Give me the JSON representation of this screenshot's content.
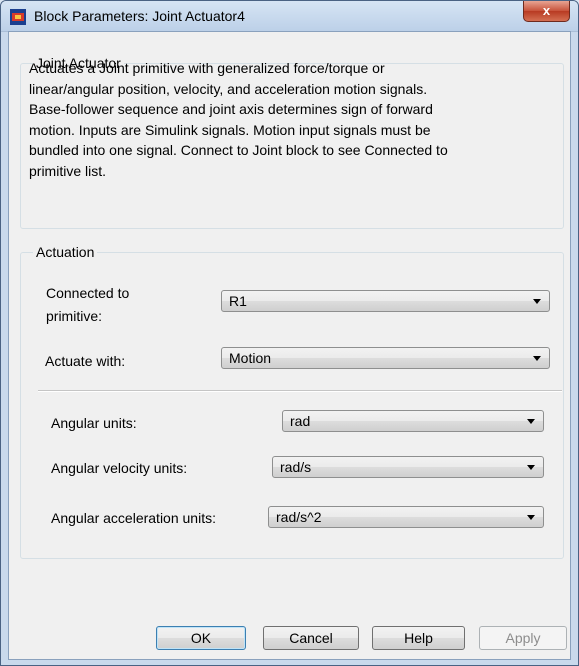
{
  "window": {
    "title": "Block Parameters: Joint Actuator4",
    "close_label": "x"
  },
  "block": {
    "group_title": "Joint Actuator",
    "description": [
      "Actuates a Joint primitive with generalized force/torque or",
      "linear/angular position, velocity, and acceleration motion signals.",
      "Base-follower sequence and joint axis determines sign of forward",
      "motion. Inputs are Simulink signals. Motion input signals must be",
      "bundled into one signal. Connect to Joint block to see Connected to",
      "primitive list."
    ]
  },
  "actuation": {
    "group_title": "Actuation",
    "connected_label_line1": "Connected to",
    "connected_label_line2": "primitive:",
    "connected_value": "R1",
    "actuate_label": "Actuate with:",
    "actuate_value": "Motion",
    "angular_units_label": "Angular units:",
    "angular_units_value": "rad",
    "angular_velocity_label": "Angular velocity units:",
    "angular_velocity_value": "rad/s",
    "angular_accel_label": "Angular acceleration units:",
    "angular_accel_value": "rad/s^2"
  },
  "buttons": {
    "ok": "OK",
    "cancel": "Cancel",
    "help": "Help",
    "apply": "Apply"
  },
  "icons": {
    "app_icon": "simulink-block-icon",
    "dropdown": "chevron-down-icon"
  }
}
